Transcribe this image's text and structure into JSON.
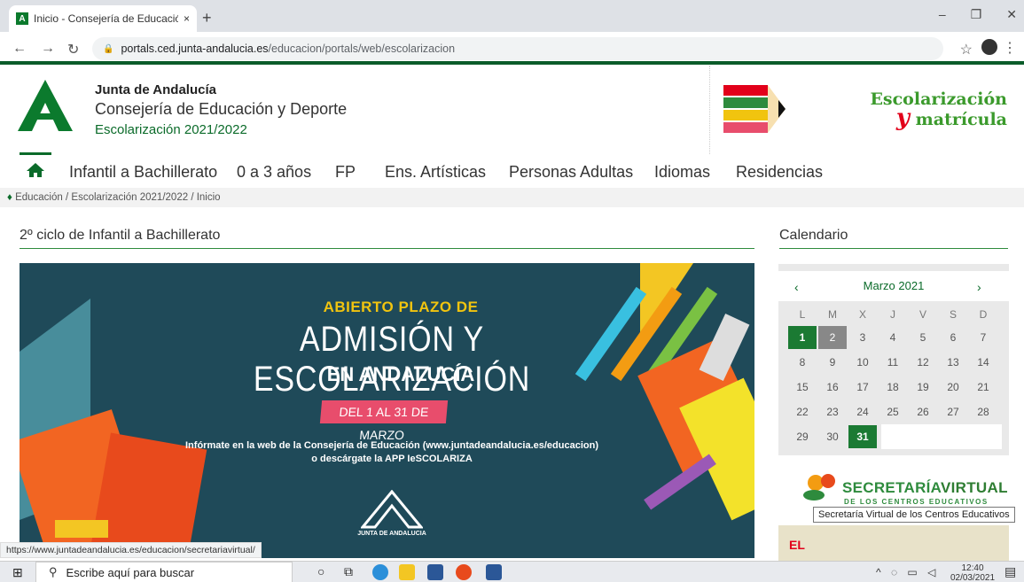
{
  "browser": {
    "tab_title": "Inicio - Consejería de Educación",
    "tab_close": "×",
    "new_tab": "+",
    "favicon_letter": "A",
    "url_domain": "portals.ced.junta-andalucia.es",
    "url_path": "/educacion/portals/web/escolarizacion",
    "status_url": "https://www.juntadeandalucia.es/educacion/secretariavirtual/"
  },
  "header": {
    "org_name": "Junta de Andalucía",
    "department": "Consejería de Educación y Deporte",
    "subtitle": "Escolarización 2021/2022",
    "banner_line1": "Escolarización",
    "banner_y": "y",
    "banner_line2": "matrícula"
  },
  "nav": {
    "items": [
      "Infantil a Bachillerato",
      "0 a 3 años",
      "FP",
      "Ens. Artísticas",
      "Personas Adultas",
      "Idiomas",
      "Residencias"
    ]
  },
  "breadcrumb": {
    "items": [
      "Educación",
      "Escolarización 2021/2022",
      "Inicio"
    ],
    "sep": "/"
  },
  "main": {
    "heading": "2º ciclo de Infantil a Bachillerato",
    "hero": {
      "line1": "ABIERTO PLAZO DE",
      "line2": "ADMISIÓN Y ESCOLARIZACIÓN",
      "line3": "EN ANDALUCÍA",
      "dates": "DEL 1 AL 31 DE MARZO",
      "info1": "Infórmate en la web de la Consejería de Educación (www.juntadeandalucia.es/educacion)",
      "info2": "o descárgate la APP IeSCOLARIZA",
      "logo_text": "JUNTA DE ANDALUCIA"
    }
  },
  "sidebar": {
    "heading": "Calendario",
    "calendar": {
      "month": "Marzo 2021",
      "prev": "‹",
      "next": "›",
      "weekdays": [
        "L",
        "M",
        "X",
        "J",
        "V",
        "S",
        "D"
      ],
      "weeks": [
        [
          "1",
          "2",
          "3",
          "4",
          "5",
          "6",
          "7"
        ],
        [
          "8",
          "9",
          "10",
          "11",
          "12",
          "13",
          "14"
        ],
        [
          "15",
          "16",
          "17",
          "18",
          "19",
          "20",
          "21"
        ],
        [
          "22",
          "23",
          "24",
          "25",
          "26",
          "27",
          "28"
        ],
        [
          "29",
          "30",
          "31"
        ]
      ]
    },
    "secretaria_title_a": "SECRETARÍA",
    "secretaria_title_b": "VIRTUAL",
    "secretaria_sub": "DE LOS CENTROS EDUCATIVOS",
    "tooltip": "Secretaría Virtual de los Centros Educativos",
    "el_text": "EL"
  },
  "taskbar": {
    "search_placeholder": "Escribe aquí para buscar",
    "time": "12:40",
    "date": "02/03/2021"
  }
}
